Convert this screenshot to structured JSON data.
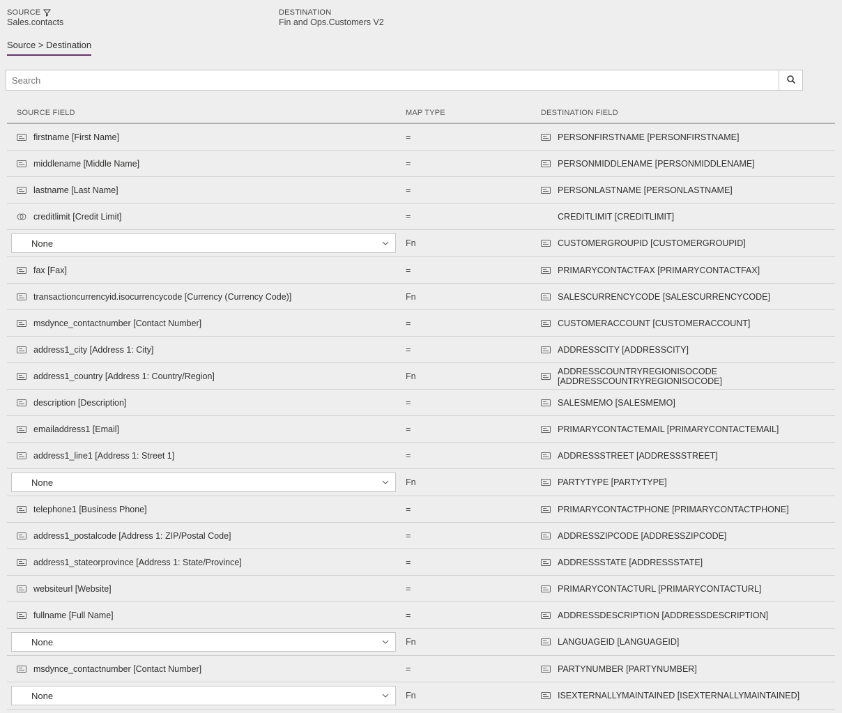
{
  "header": {
    "source_label": "SOURCE",
    "source_value": "Sales.contacts",
    "destination_label": "DESTINATION",
    "destination_value": "Fin and Ops.Customers V2"
  },
  "tab": {
    "label": "Source > Destination"
  },
  "search": {
    "placeholder": "Search"
  },
  "columns": {
    "source": "SOURCE FIELD",
    "map": "MAP TYPE",
    "destination": "DESTINATION FIELD"
  },
  "dropdown_none": "None",
  "rows": [
    {
      "src_icon": "text",
      "src": "firstname [First Name]",
      "map": "=",
      "dst_icon": "text",
      "dst": "PERSONFIRSTNAME [PERSONFIRSTNAME]"
    },
    {
      "src_icon": "text",
      "src": "middlename [Middle Name]",
      "map": "=",
      "dst_icon": "text",
      "dst": "PERSONMIDDLENAME [PERSONMIDDLENAME]"
    },
    {
      "src_icon": "text",
      "src": "lastname [Last Name]",
      "map": "=",
      "dst_icon": "text",
      "dst": "PERSONLASTNAME [PERSONLASTNAME]"
    },
    {
      "src_icon": "currency",
      "src": "creditlimit [Credit Limit]",
      "map": "=",
      "dst_icon": "",
      "dst": "CREDITLIMIT [CREDITLIMIT]"
    },
    {
      "src_icon": "dropdown",
      "src": "None",
      "map": "Fn",
      "dst_icon": "text",
      "dst": "CUSTOMERGROUPID [CUSTOMERGROUPID]"
    },
    {
      "src_icon": "text",
      "src": "fax [Fax]",
      "map": "=",
      "dst_icon": "text",
      "dst": "PRIMARYCONTACTFAX [PRIMARYCONTACTFAX]"
    },
    {
      "src_icon": "text",
      "src": "transactioncurrencyid.isocurrencycode [Currency (Currency Code)]",
      "map": "Fn",
      "dst_icon": "text",
      "dst": "SALESCURRENCYCODE [SALESCURRENCYCODE]"
    },
    {
      "src_icon": "text",
      "src": "msdynce_contactnumber [Contact Number]",
      "map": "=",
      "dst_icon": "text",
      "dst": "CUSTOMERACCOUNT [CUSTOMERACCOUNT]"
    },
    {
      "src_icon": "text",
      "src": "address1_city [Address 1: City]",
      "map": "=",
      "dst_icon": "text",
      "dst": "ADDRESSCITY [ADDRESSCITY]"
    },
    {
      "src_icon": "text",
      "src": "address1_country [Address 1: Country/Region]",
      "map": "Fn",
      "dst_icon": "text",
      "dst": "ADDRESSCOUNTRYREGIONISOCODE [ADDRESSCOUNTRYREGIONISOCODE]"
    },
    {
      "src_icon": "text",
      "src": "description [Description]",
      "map": "=",
      "dst_icon": "text",
      "dst": "SALESMEMO [SALESMEMO]"
    },
    {
      "src_icon": "text",
      "src": "emailaddress1 [Email]",
      "map": "=",
      "dst_icon": "text",
      "dst": "PRIMARYCONTACTEMAIL [PRIMARYCONTACTEMAIL]"
    },
    {
      "src_icon": "text",
      "src": "address1_line1 [Address 1: Street 1]",
      "map": "=",
      "dst_icon": "text",
      "dst": "ADDRESSSTREET [ADDRESSSTREET]"
    },
    {
      "src_icon": "dropdown",
      "src": "None",
      "map": "Fn",
      "dst_icon": "text",
      "dst": "PARTYTYPE [PARTYTYPE]"
    },
    {
      "src_icon": "text",
      "src": "telephone1 [Business Phone]",
      "map": "=",
      "dst_icon": "text",
      "dst": "PRIMARYCONTACTPHONE [PRIMARYCONTACTPHONE]"
    },
    {
      "src_icon": "text",
      "src": "address1_postalcode [Address 1: ZIP/Postal Code]",
      "map": "=",
      "dst_icon": "text",
      "dst": "ADDRESSZIPCODE [ADDRESSZIPCODE]"
    },
    {
      "src_icon": "text",
      "src": "address1_stateorprovince [Address 1: State/Province]",
      "map": "=",
      "dst_icon": "text",
      "dst": "ADDRESSSTATE [ADDRESSSTATE]"
    },
    {
      "src_icon": "text",
      "src": "websiteurl [Website]",
      "map": "=",
      "dst_icon": "text",
      "dst": "PRIMARYCONTACTURL [PRIMARYCONTACTURL]"
    },
    {
      "src_icon": "text",
      "src": "fullname [Full Name]",
      "map": "=",
      "dst_icon": "text",
      "dst": "ADDRESSDESCRIPTION [ADDRESSDESCRIPTION]"
    },
    {
      "src_icon": "dropdown",
      "src": "None",
      "map": "Fn",
      "dst_icon": "text",
      "dst": "LANGUAGEID [LANGUAGEID]"
    },
    {
      "src_icon": "text",
      "src": "msdynce_contactnumber [Contact Number]",
      "map": "=",
      "dst_icon": "text",
      "dst": "PARTYNUMBER [PARTYNUMBER]"
    },
    {
      "src_icon": "dropdown",
      "src": "None",
      "map": "Fn",
      "dst_icon": "text",
      "dst": "ISEXTERNALLYMAINTAINED [ISEXTERNALLYMAINTAINED]"
    }
  ]
}
